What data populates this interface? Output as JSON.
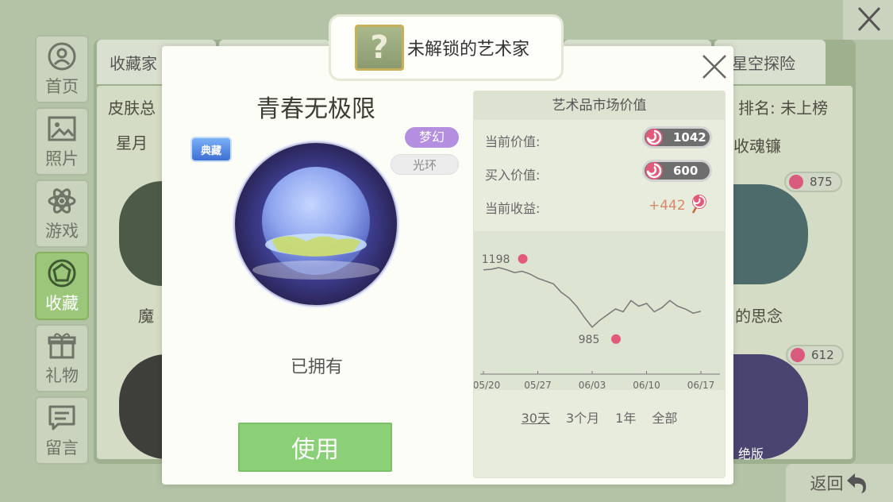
{
  "background": {
    "tabs": [
      "收藏家",
      "星空探险"
    ],
    "sidebar": [
      {
        "label": "首页",
        "icon": "user-icon"
      },
      {
        "label": "照片",
        "icon": "photo-icon"
      },
      {
        "label": "游戏",
        "icon": "atom-icon"
      },
      {
        "label": "收藏",
        "icon": "gem-icon",
        "active": true
      },
      {
        "label": "礼物",
        "icon": "gift-icon"
      },
      {
        "label": "留言",
        "icon": "message-icon"
      }
    ],
    "skin_label": "皮肤总",
    "rank_label": "排名: 未上榜",
    "left_item_name": "星月",
    "right_item_name": "收魂镰",
    "left_item_name2": "魔",
    "right_item_name2": "的思念",
    "coin_top": "875",
    "coin_bottom": "612",
    "edition_label": "绝版",
    "back_label": "返回"
  },
  "banner": {
    "label": "未解锁的艺术家",
    "icon": "question-icon"
  },
  "item": {
    "title": "青春无极限",
    "classic_badge": "典藏",
    "tag_dream": "梦幻",
    "tag_halo": "光环",
    "status": "已拥有",
    "use_button": "使用"
  },
  "market": {
    "title": "艺术品市场价值",
    "current_value_label": "当前价值:",
    "current_value": "1042",
    "buy_value_label": "买入价值:",
    "buy_value": "600",
    "gain_label": "当前收益:",
    "gain_value": "+442",
    "ranges": [
      "30天",
      "3个月",
      "1年",
      "全部"
    ],
    "active_range": "30天"
  },
  "colors": {
    "accent_green": "#8bcf76",
    "candy_red": "#d95a7c",
    "purple_tag": "#b48ee0"
  },
  "chart_data": {
    "type": "line",
    "x": [
      "05/20",
      "05/21",
      "05/22",
      "05/23",
      "05/24",
      "05/25",
      "05/26",
      "05/27",
      "05/28",
      "05/29",
      "05/30",
      "05/31",
      "06/01",
      "06/02",
      "06/03",
      "06/04",
      "06/05",
      "06/06",
      "06/07",
      "06/08",
      "06/09",
      "06/10",
      "06/11",
      "06/12",
      "06/13",
      "06/14",
      "06/15",
      "06/16",
      "06/17"
    ],
    "series": [
      {
        "values": [
          1190,
          1192,
          1198,
          1190,
          1180,
          1185,
          1175,
          1160,
          1150,
          1140,
          1110,
          1090,
          1060,
          1020,
          985,
          1010,
          1030,
          1050,
          1040,
          1080,
          1060,
          1070,
          1040,
          1055,
          1080,
          1060,
          1050,
          1035,
          1042
        ]
      }
    ],
    "x_ticks": [
      "05/20",
      "05/27",
      "06/03",
      "06/10",
      "06/17"
    ],
    "annotations": [
      {
        "label": "1198",
        "x": "05/22",
        "y": 1198
      },
      {
        "label": "985",
        "x": "06/03",
        "y": 985
      }
    ],
    "ylim": [
      800,
      1300
    ],
    "grid": false
  }
}
